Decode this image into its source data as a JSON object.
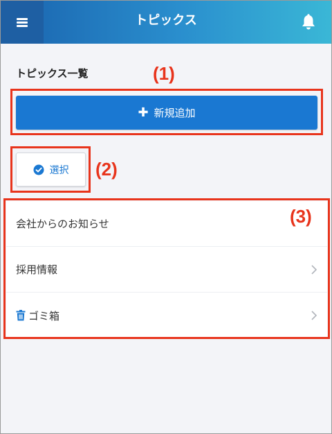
{
  "header": {
    "title": "トピックス"
  },
  "section": {
    "title": "トピックス一覧"
  },
  "actions": {
    "add_label": "新規追加",
    "select_label": "選択"
  },
  "list": {
    "items": [
      {
        "label": "会社からのお知らせ",
        "icon": "",
        "chevron": false
      },
      {
        "label": "採用情報",
        "icon": "",
        "chevron": true
      },
      {
        "label": "ゴミ箱",
        "icon": "trash-icon",
        "chevron": true
      }
    ]
  },
  "annotations": {
    "a1": "(1)",
    "a2": "(2)",
    "a3": "(3)"
  },
  "colors": {
    "annotation": "#e8341c",
    "primary": "#1a78d2",
    "header_dark": "#1e5fa3"
  }
}
